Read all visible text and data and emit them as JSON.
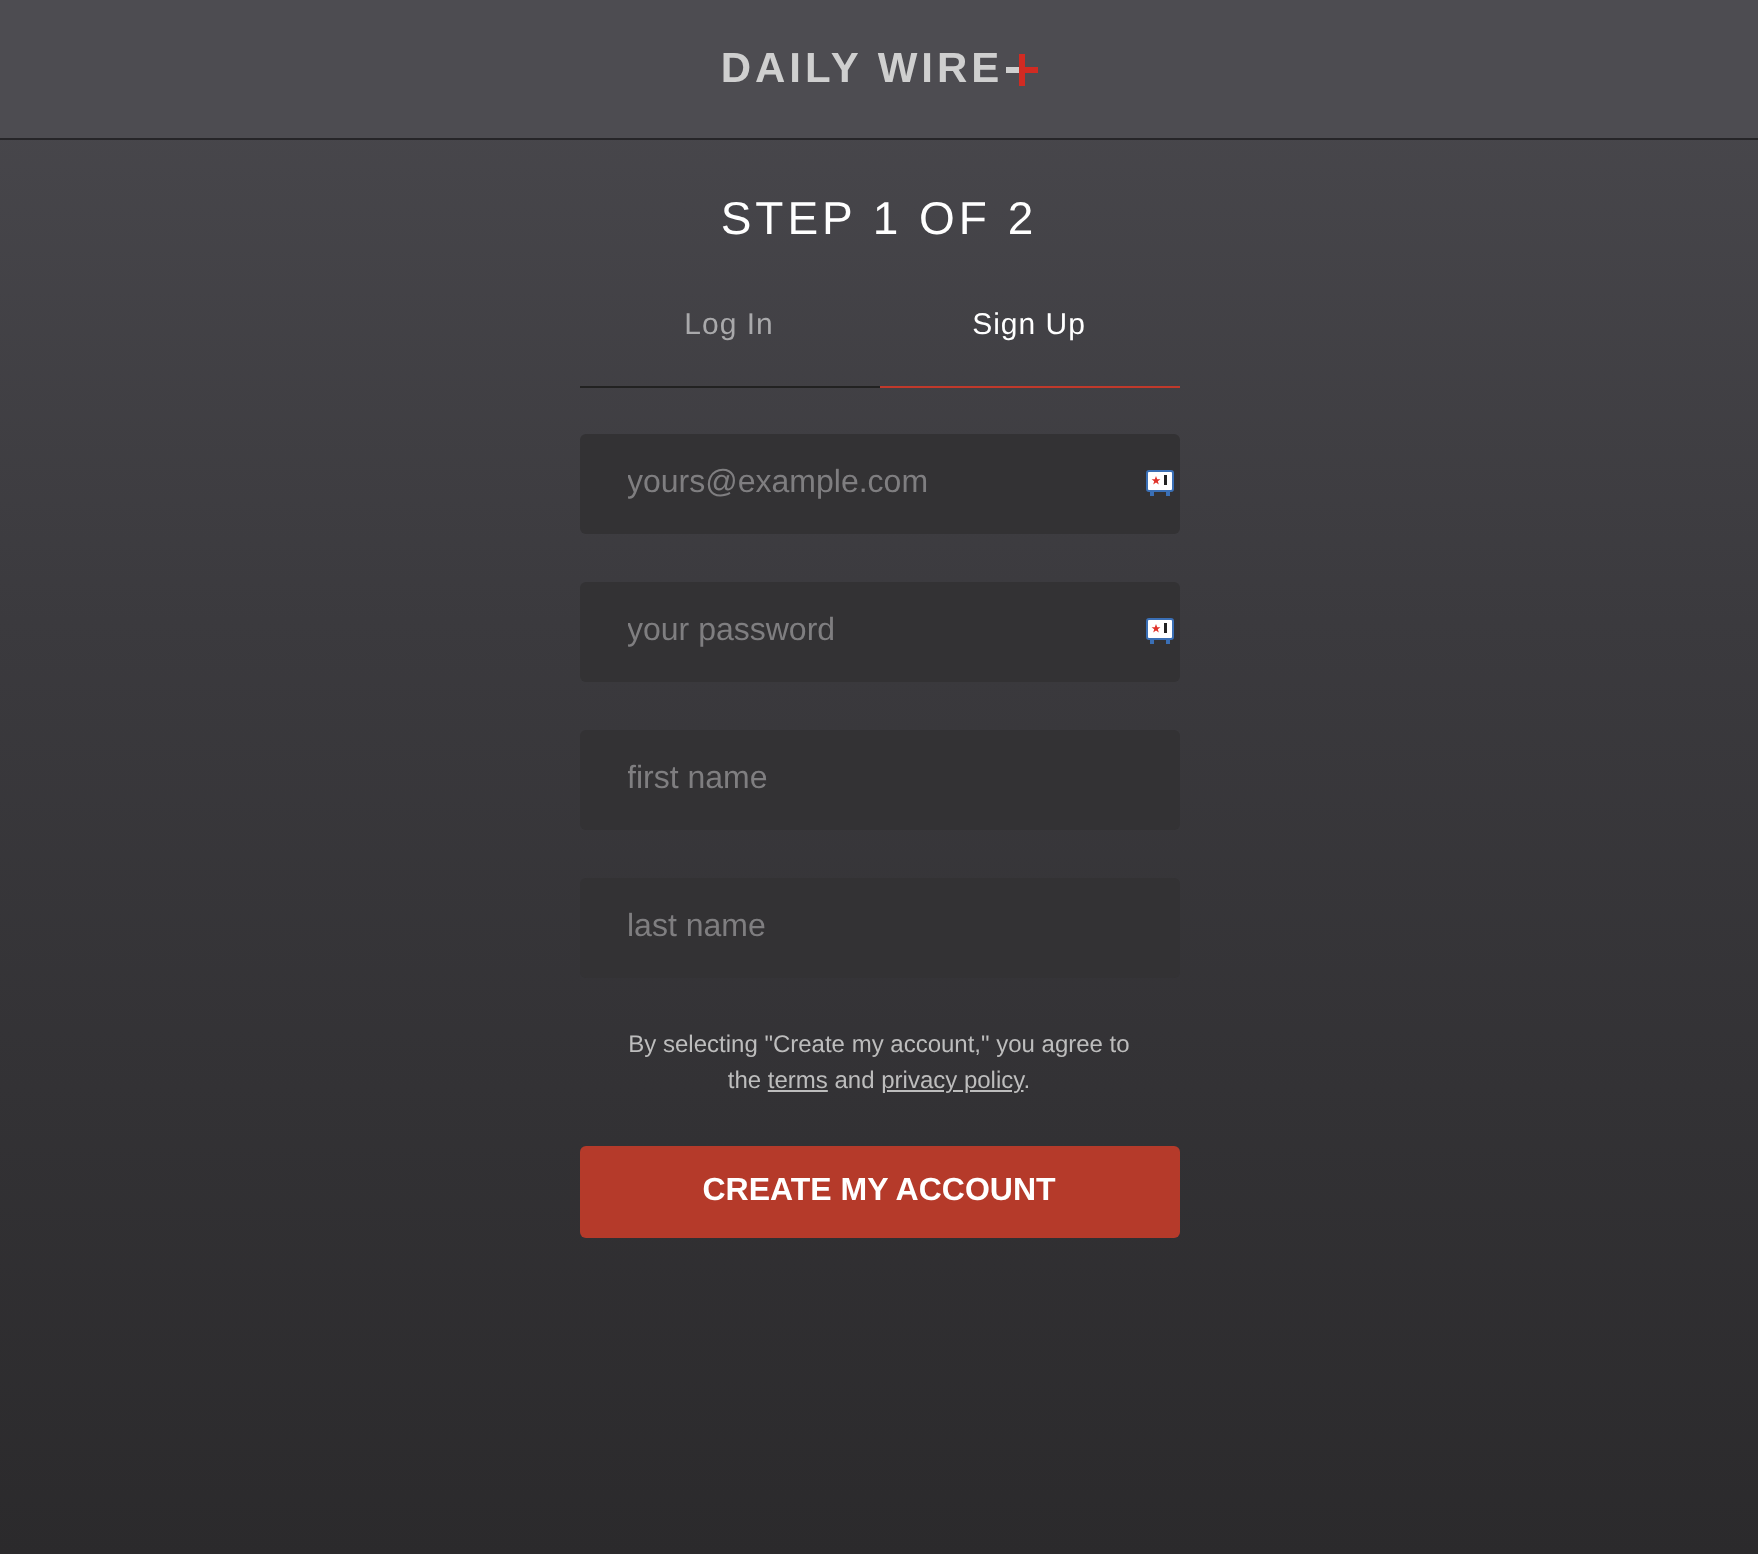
{
  "header": {
    "logo_text": "DAILY WIRE"
  },
  "step_title": "STEP 1 OF 2",
  "tabs": [
    {
      "label": "Log In",
      "selected": false
    },
    {
      "label": "Sign Up",
      "selected": true
    }
  ],
  "fields": [
    {
      "placeholder": "yours@example.com",
      "autofill_icon": true
    },
    {
      "placeholder": "your password",
      "autofill_icon": true
    },
    {
      "placeholder": "first name",
      "autofill_icon": false
    },
    {
      "placeholder": "last name",
      "autofill_icon": false
    }
  ],
  "consent": {
    "before": "By selecting \"Create my account,\" you agree to the ",
    "terms_link": "terms",
    "middle": " and ",
    "privacy_link": "privacy policy",
    "after": "."
  },
  "submit_button": "CREATE MY ACCOUNT"
}
